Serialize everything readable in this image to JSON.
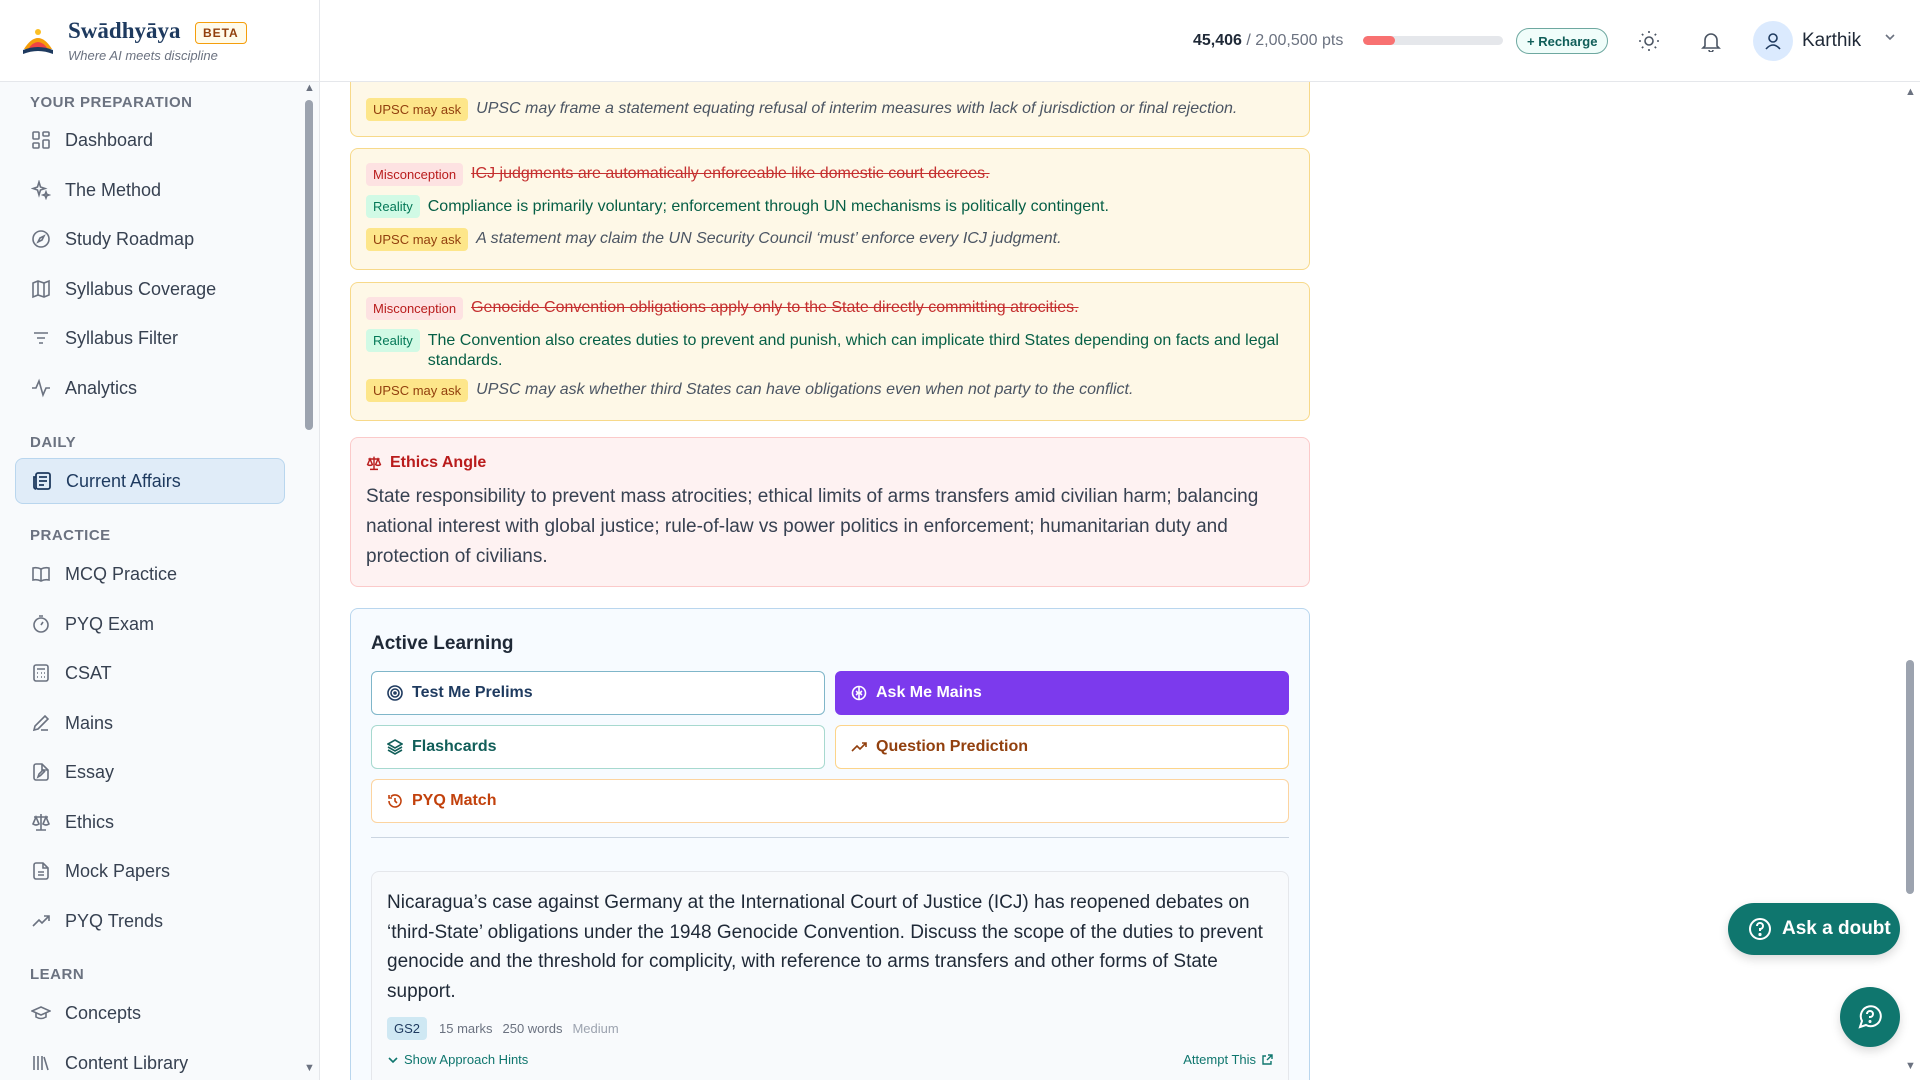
{
  "brand": {
    "name": "Swādhyāya",
    "badge": "BETA",
    "tagline": "Where AI meets discipline"
  },
  "header": {
    "points_current": "45,406",
    "points_total": "/ 2,00,500 pts",
    "points_fraction": 0.23,
    "recharge_label": "+ Recharge",
    "user_name": "Karthik"
  },
  "sidebar": {
    "sections": {
      "preparation": "YOUR PREPARATION",
      "daily": "DAILY",
      "practice": "PRACTICE",
      "learn": "LEARN"
    },
    "items": {
      "dashboard": "Dashboard",
      "method": "The Method",
      "roadmap": "Study Roadmap",
      "coverage": "Syllabus Coverage",
      "filter": "Syllabus Filter",
      "analytics": "Analytics",
      "current_affairs": "Current Affairs",
      "mcq": "MCQ Practice",
      "pyq_exam": "PYQ Exam",
      "csat": "CSAT",
      "mains": "Mains",
      "essay": "Essay",
      "ethics": "Ethics",
      "mock": "Mock Papers",
      "pyq_trends": "PYQ Trends",
      "concepts": "Concepts",
      "library": "Content Library"
    }
  },
  "labels": {
    "misconception": "Misconception",
    "reality": "Reality",
    "upsc": "UPSC may ask"
  },
  "misconceptions": [
    {
      "upsc": "UPSC may frame a statement equating refusal of interim measures with lack of jurisdiction or final rejection."
    },
    {
      "misconception": "ICJ judgments are automatically enforceable like domestic court decrees.",
      "reality": "Compliance is primarily voluntary; enforcement through UN mechanisms is politically contingent.",
      "upsc": "A statement may claim the UN Security Council ‘must’ enforce every ICJ judgment."
    },
    {
      "misconception": "Genocide Convention obligations apply only to the State directly committing atrocities.",
      "reality": "The Convention also creates duties to prevent and punish, which can implicate third States depending on facts and legal standards.",
      "upsc": "UPSC may ask whether third States can have obligations even when not party to the conflict."
    }
  ],
  "ethics": {
    "title": "Ethics Angle",
    "body": "State responsibility to prevent mass atrocities; ethical limits of arms transfers amid civilian harm; balancing national interest with global justice; rule-of-law vs power politics in enforcement; humanitarian duty and protection of civilians."
  },
  "active_learning": {
    "title": "Active Learning",
    "buttons": {
      "prelims": "Test Me Prelims",
      "mains": "Ask Me Mains",
      "flashcards": "Flashcards",
      "prediction": "Question Prediction",
      "pyq_match": "PYQ Match"
    },
    "question": {
      "text": "Nicaragua’s case against Germany at the International Court of Justice (ICJ) has reopened debates on ‘third-State’ obligations under the 1948 Genocide Convention. Discuss the scope of the duties to prevent genocide and the threshold for complicity, with reference to arms transfers and other forms of State support.",
      "paper": "GS2",
      "marks": "15 marks",
      "words": "250 words",
      "level": "Medium",
      "hints_label": "Show Approach Hints",
      "attempt_label": "Attempt This"
    }
  },
  "fab": {
    "ask_label": "Ask a doubt"
  },
  "colors": {
    "accent": "#0f766e",
    "mains_button": "#7c3aed",
    "active_nav": "#e0ecf8"
  }
}
